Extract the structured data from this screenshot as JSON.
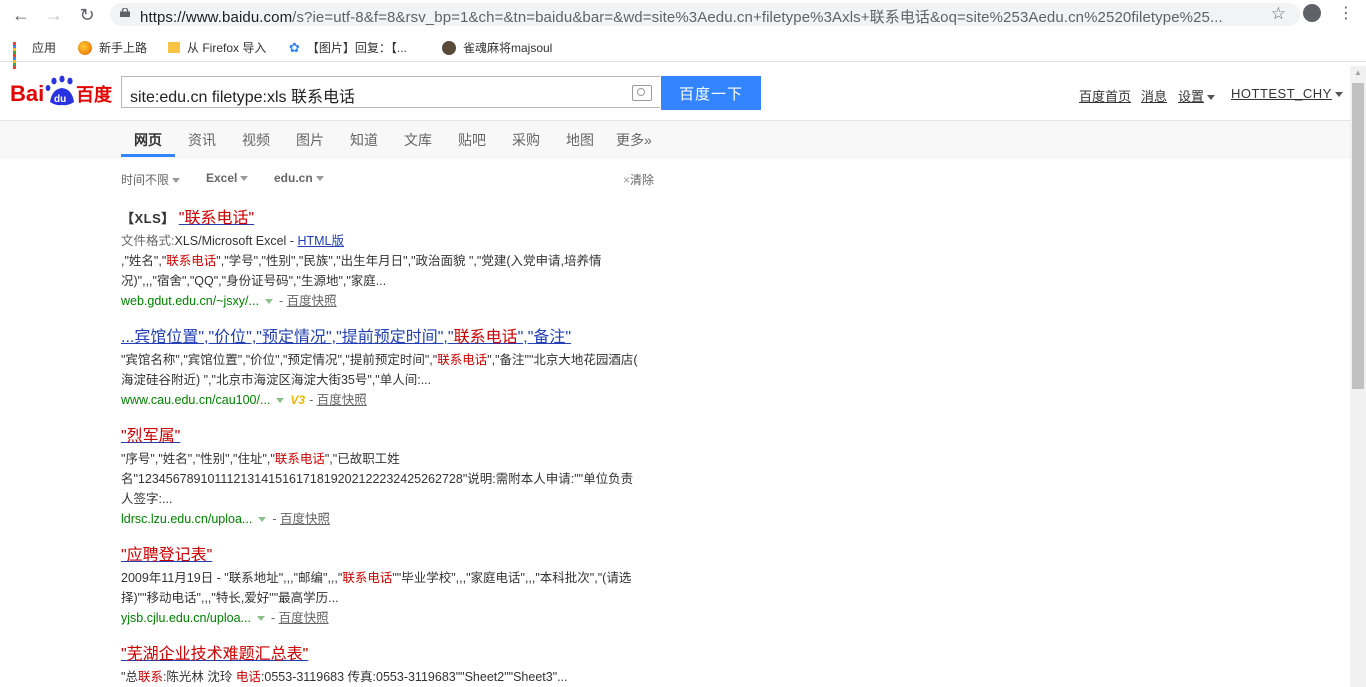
{
  "browser": {
    "url_host": "https://www.baidu.com",
    "url_rest": "/s?ie=utf-8&f=8&rsv_bp=1&ch=&tn=baidu&bar=&wd=site%3Aedu.cn+filetype%3Axls+联系电话&oq=site%253Aedu.cn%2520filetype%25...",
    "bookmarks": [
      {
        "label": "应用"
      },
      {
        "label": "新手上路"
      },
      {
        "label": "从 Firefox 导入"
      },
      {
        "label": "【图片】回复：【..."
      },
      {
        "label": "雀魂麻将majsoul"
      }
    ]
  },
  "search": {
    "query": "site:edu.cn filetype:xls 联系电话",
    "button": "百度一下"
  },
  "header_links": {
    "home": "百度首页",
    "messages": "消息",
    "settings": "设置",
    "user": "HOTTEST_CHY"
  },
  "tabs": [
    "网页",
    "资讯",
    "视频",
    "图片",
    "知道",
    "文库",
    "贴吧",
    "采购",
    "地图",
    "更多»"
  ],
  "filters": {
    "time": "时间不限",
    "filetype": "Excel",
    "site": "edu.cn",
    "clear": "清除"
  },
  "results": [
    {
      "tag": "【XLS】",
      "title": "\"联系电话\"",
      "format_label": "文件格式:",
      "format_value": "XLS/Microsoft Excel - ",
      "format_link": "HTML版",
      "snippet_1a": ",\"姓名\",\"",
      "snippet_1hl": "联系电话",
      "snippet_1b": "\",\"学号\",\"性别\",\"民族\",\"出生年月日\",\"政治面貌 \",\"党建(入党申请,培养情",
      "snippet_2": "况)\",,,\"宿舍\",\"QQ\",\"身份证号码\",\"生源地\",\"家庭...",
      "url": "web.gdut.edu.cn/~jsxy/...",
      "snapshot": "百度快照"
    },
    {
      "title_a": "...宾馆位置\",\"价位\",\"预定情况\",\"提前预定时间\",\"",
      "title_hl": "联系电话",
      "title_b": "\",\"备注\"",
      "snippet_1a": "\"宾馆名称\",\"宾馆位置\",\"价位\",\"预定情况\",\"提前预定时间\",\"",
      "snippet_1hl": "联系电话",
      "snippet_1b": "\",\"备注\"\"北京大地花园酒店(",
      "snippet_2": "海淀硅谷附近) \",\"北京市海淀区海淀大街35号\",\"单人间:...",
      "url": "www.cau.edu.cn/cau100/...",
      "badge": "V3",
      "snapshot": "百度快照"
    },
    {
      "title": "\"烈军属\"",
      "snippet_1a": "\"序号\",\"姓名\",\"性别\",\"住址\",\"",
      "snippet_1hl": "联系电话",
      "snippet_1b": "\",\"已故职工姓",
      "snippet_2": "名\"12345678910111213141516171819202122232425262728\"说明:需附本人申请:\"\"单位负责",
      "snippet_3": "人签字:...",
      "url": "ldrsc.lzu.edu.cn/uploa...",
      "snapshot": "百度快照"
    },
    {
      "title": "\"应聘登记表\"",
      "snippet_1a": "2009年11月19日 - \"联系地址\",,,\"邮编\",,,\"",
      "snippet_1hl": "联系电话",
      "snippet_1b": "\"\"毕业学校\",,,\"家庭电话\",,,\"本科批次\",\"(请选",
      "snippet_2": "择)\"\"移动电话\",,,\"特长,爱好\"\"最高学历...",
      "url": "yjsb.cjlu.edu.cn/uploa...",
      "snapshot": "百度快照"
    },
    {
      "title": "\"芜湖企业技术难题汇总表\"",
      "snippet_1a": "\"总",
      "snippet_1hl": "联系",
      "snippet_1b": ":陈光林 沈玲 ",
      "snippet_1hl2": "电话",
      "snippet_1c": ":0553-3119683 传真:0553-3119683\"\"Sheet2\"\"Sheet3\"..."
    }
  ]
}
